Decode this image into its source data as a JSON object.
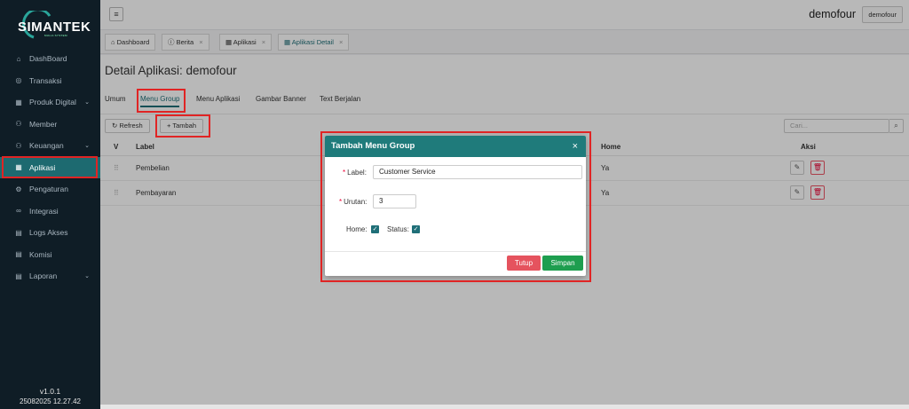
{
  "brand": {
    "name": "SIMANTEK",
    "tagline": "MULIA SYSTEM"
  },
  "sidebar": {
    "items": [
      {
        "label": "DashBoard",
        "icon": "home-icon"
      },
      {
        "label": "Transaksi",
        "icon": "circle-icon"
      },
      {
        "label": "Produk Digital",
        "icon": "grid-icon",
        "has_children": true
      },
      {
        "label": "Member",
        "icon": "users-icon"
      },
      {
        "label": "Keuangan",
        "icon": "users-icon",
        "has_children": true
      },
      {
        "label": "Aplikasi",
        "icon": "grid-icon",
        "active": true
      },
      {
        "label": "Pengaturan",
        "icon": "gear-icon"
      },
      {
        "label": "Integrasi",
        "icon": "link-icon"
      },
      {
        "label": "Logs Akses",
        "icon": "file-icon"
      },
      {
        "label": "Komisi",
        "icon": "file-icon"
      },
      {
        "label": "Laporan",
        "icon": "file-icon",
        "has_children": true
      }
    ],
    "version": "v1.0.1",
    "build": "25082025 12.27.42"
  },
  "header": {
    "user_name": "demofour",
    "user_button": "demofour"
  },
  "tabs": [
    {
      "label": "Dashboard",
      "closable": false
    },
    {
      "label": "Berita",
      "closable": true
    },
    {
      "label": "Aplikasi",
      "closable": true
    },
    {
      "label": "Aplikasi Detail",
      "closable": true,
      "active": true
    }
  ],
  "page": {
    "title": "Detail Aplikasi: demofour",
    "subtabs": [
      "Umum",
      "Menu Group",
      "Menu Aplikasi",
      "Gambar Banner",
      "Text Berjalan"
    ],
    "refresh_label": "Refresh",
    "add_label": "Tambah",
    "search_placeholder": "Cari..."
  },
  "table": {
    "columns": {
      "v": "V",
      "label": "Label",
      "home": "Home",
      "aksi": "Aksi"
    },
    "rows": [
      {
        "label": "Pembelian",
        "home": "Ya"
      },
      {
        "label": "Pembayaran",
        "home": "Ya"
      }
    ]
  },
  "modal": {
    "title": "Tambah Menu Group",
    "label_field": "Label",
    "label_value": "Customer Service",
    "urutan_field": "Urutan",
    "urutan_value": "3",
    "home_field": "Home",
    "status_field": "Status",
    "home_checked": true,
    "status_checked": true,
    "cancel_label": "Tutup",
    "save_label": "Simpan"
  },
  "colors": {
    "accent": "#1f7b7b",
    "sidebar_bg": "#0f1d26",
    "danger": "#e5535e",
    "success": "#1e9e4f",
    "highlight": "#e02424"
  }
}
